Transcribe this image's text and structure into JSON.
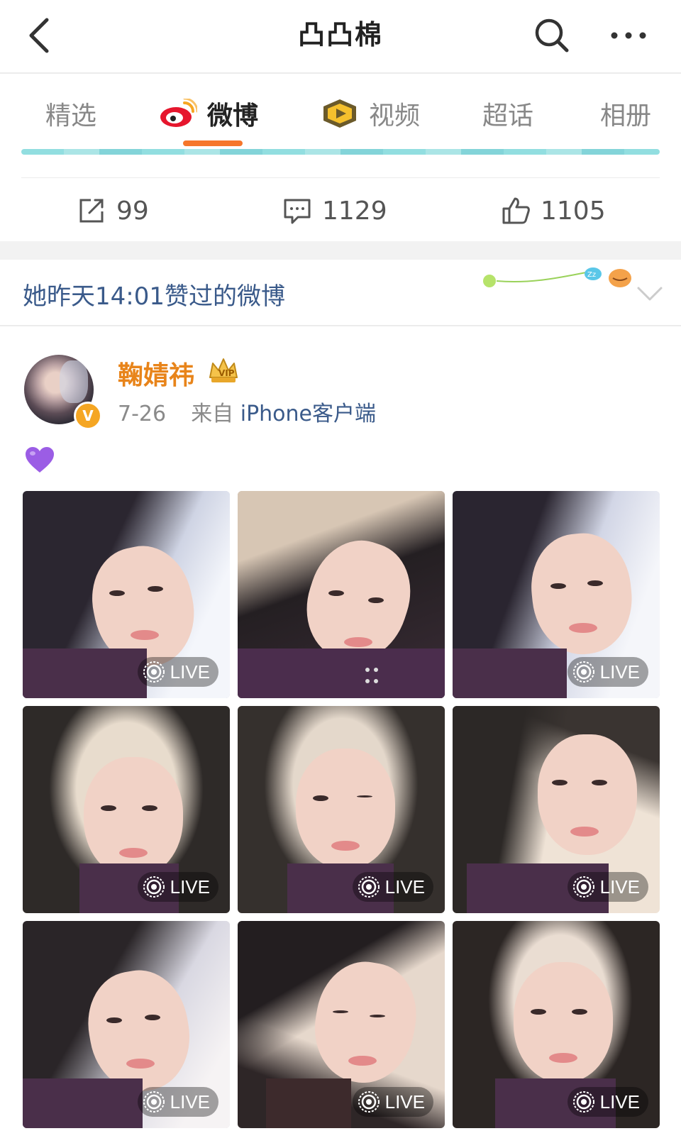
{
  "topbar": {
    "title": "凸凸棉"
  },
  "tabs": [
    {
      "label": "精选",
      "active": false
    },
    {
      "label": "微博",
      "active": true
    },
    {
      "label": "视频",
      "active": false
    },
    {
      "label": "超话",
      "active": false
    },
    {
      "label": "相册",
      "active": false
    }
  ],
  "actions": {
    "repost_count": "99",
    "comment_count": "1129",
    "like_count": "1105"
  },
  "liked": {
    "text": "她昨天14:01赞过的微博"
  },
  "post": {
    "author": "鞠婧祎",
    "date": "7-26",
    "from_prefix": "来自",
    "source": "iPhone客户端",
    "content_emoji": "purple-heart"
  },
  "grid": {
    "live_label": "LIVE",
    "images": [
      {
        "live": true
      },
      {
        "live": false
      },
      {
        "live": true
      },
      {
        "live": true
      },
      {
        "live": true
      },
      {
        "live": true
      },
      {
        "live": true
      },
      {
        "live": true
      },
      {
        "live": true
      }
    ]
  },
  "colors": {
    "accent": "#f6762b",
    "author": "#e8841a",
    "link": "#3a5a8a"
  }
}
